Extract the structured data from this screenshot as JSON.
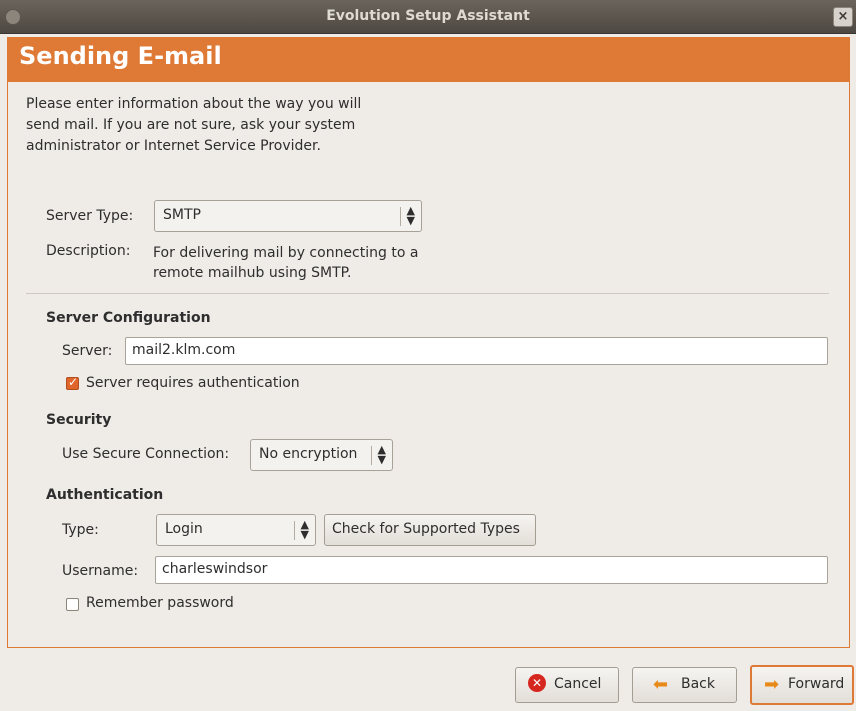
{
  "window": {
    "title": "Evolution Setup Assistant"
  },
  "header": {
    "title": "Sending E-mail"
  },
  "intro": "Please enter information about the way you will send mail. If you are not sure, ask your system administrator or Internet Service Provider.",
  "server_type": {
    "label": "Server Type:",
    "value": "SMTP",
    "description_label": "Description:",
    "description": "For delivering mail by connecting to a remote mailhub using SMTP."
  },
  "server_config": {
    "heading": "Server Configuration",
    "server_label": "Server:",
    "server_value": "mail2.klm.com",
    "auth_required_label": "Server requires authentication",
    "auth_required_checked": true
  },
  "security": {
    "heading": "Security",
    "secure_label": "Use Secure Connection:",
    "secure_value": "No encryption"
  },
  "authentication": {
    "heading": "Authentication",
    "type_label": "Type:",
    "type_value": "Login",
    "check_button": "Check for Supported Types",
    "username_label": "Username:",
    "username_value": "charleswindsor",
    "remember_label": "Remember password",
    "remember_checked": false
  },
  "buttons": {
    "cancel": "Cancel",
    "back": "Back",
    "forward": "Forward"
  },
  "colors": {
    "accent": "#df7936",
    "titlebar": "#5a544d"
  }
}
